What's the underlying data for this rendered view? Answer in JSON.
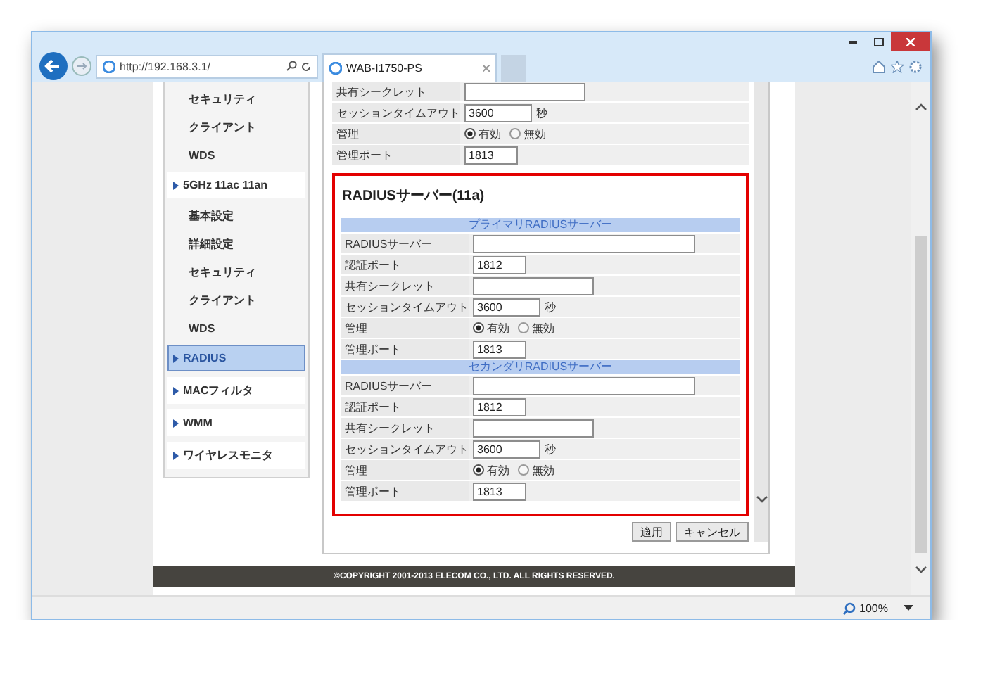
{
  "browser": {
    "url": "http://192.168.3.1/",
    "tab_title": "WAB-I1750-PS",
    "zoom": "100%"
  },
  "sidebar": {
    "items": [
      {
        "kind": "sub",
        "label": "セキュリティ",
        "selected": false
      },
      {
        "kind": "sub",
        "label": "クライアント",
        "selected": false
      },
      {
        "kind": "sub",
        "label": "WDS",
        "selected": false
      },
      {
        "kind": "group",
        "label": "5GHz 11ac 11an",
        "selected": false,
        "children": [
          {
            "label": "基本設定",
            "selected": false
          },
          {
            "label": "詳細設定",
            "selected": false
          },
          {
            "label": "セキュリティ",
            "selected": false
          },
          {
            "label": "クライアント",
            "selected": false
          },
          {
            "label": "WDS",
            "selected": false
          }
        ]
      },
      {
        "kind": "group",
        "label": "RADIUS",
        "selected": true
      },
      {
        "kind": "group",
        "label": "MACフィルタ",
        "selected": false
      },
      {
        "kind": "group",
        "label": "WMM",
        "selected": false
      },
      {
        "kind": "group",
        "label": "ワイヤレスモニタ",
        "selected": false
      }
    ]
  },
  "main": {
    "partial_rows": [
      {
        "kind": "medium-field",
        "label": "共有シークレット"
      },
      {
        "kind": "unit-field",
        "label": "セッションタイムアウト",
        "value": "3600",
        "unit": "秒"
      },
      {
        "kind": "radio",
        "label": "管理",
        "options": [
          {
            "label": "有効",
            "selected": true
          },
          {
            "label": "無効",
            "selected": false
          }
        ]
      },
      {
        "kind": "field",
        "label": "管理ポート",
        "value": "1813"
      }
    ],
    "section": {
      "title": "RADIUSサーバー(11a)",
      "highlighted": true,
      "groups": [
        {
          "heading": "プライマリRADIUSサーバー",
          "rows": [
            {
              "kind": "wide-field",
              "label": "RADIUSサーバー"
            },
            {
              "kind": "field",
              "label": "認証ポート",
              "value": "1812"
            },
            {
              "kind": "medium-field",
              "label": "共有シークレット"
            },
            {
              "kind": "unit-field",
              "label": "セッションタイムアウト",
              "value": "3600",
              "unit": "秒"
            },
            {
              "kind": "radio",
              "label": "管理",
              "options": [
                {
                  "label": "有効",
                  "selected": true
                },
                {
                  "label": "無効",
                  "selected": false
                }
              ]
            },
            {
              "kind": "field",
              "label": "管理ポート",
              "value": "1813"
            }
          ]
        },
        {
          "heading": "セカンダリRADIUSサーバー",
          "rows": [
            {
              "kind": "wide-field",
              "label": "RADIUSサーバー"
            },
            {
              "kind": "field",
              "label": "認証ポート",
              "value": "1812"
            },
            {
              "kind": "medium-field",
              "label": "共有シークレット"
            },
            {
              "kind": "unit-field",
              "label": "セッションタイムアウト",
              "value": "3600",
              "unit": "秒"
            },
            {
              "kind": "radio",
              "label": "管理",
              "options": [
                {
                  "label": "有効",
                  "selected": true
                },
                {
                  "label": "無効",
                  "selected": false
                }
              ]
            },
            {
              "kind": "field",
              "label": "管理ポート",
              "value": "1813"
            }
          ]
        }
      ]
    },
    "buttons": [
      "適用",
      "キャンセル"
    ]
  },
  "footer": "©COPYRIGHT 2001-2013 ELECOM CO., LTD. ALL RIGHTS RESERVED."
}
